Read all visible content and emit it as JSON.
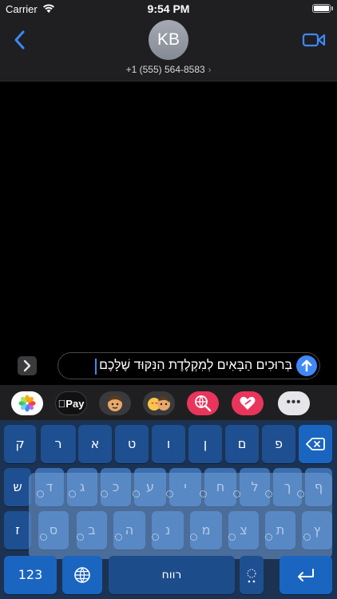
{
  "status_bar": {
    "carrier": "Carrier",
    "time": "9:54 PM"
  },
  "header": {
    "avatar_initials": "KB",
    "contact_phone": "+1 (555) 564-8583",
    "contact_chevron": "›"
  },
  "compose": {
    "text": "בְּרוּכִים הַבָּאִים לְמִקְלֶדֶת הַנִּקּוּד שֶׁלָּכֶם"
  },
  "apps": {
    "apple_pay_label": "Pay",
    "more_label": "•••"
  },
  "keyboard": {
    "row1": [
      "ק",
      "ר",
      "א",
      "ט",
      "ו",
      "ן",
      "ם",
      "פ"
    ],
    "row2": [
      "ש",
      "ד",
      "ג",
      "כ",
      "ע",
      "י",
      "ח",
      "ל",
      "ך",
      "ף"
    ],
    "row3": [
      "ז",
      "ס",
      "ב",
      "ה",
      "נ",
      "מ",
      "צ",
      "ת",
      "ץ"
    ],
    "numbers_label": "123",
    "space_label": "רווח"
  },
  "colors": {
    "accent": "#3f88f6",
    "keyboard_bg": "#1b3252",
    "key": "#1e4f91"
  }
}
